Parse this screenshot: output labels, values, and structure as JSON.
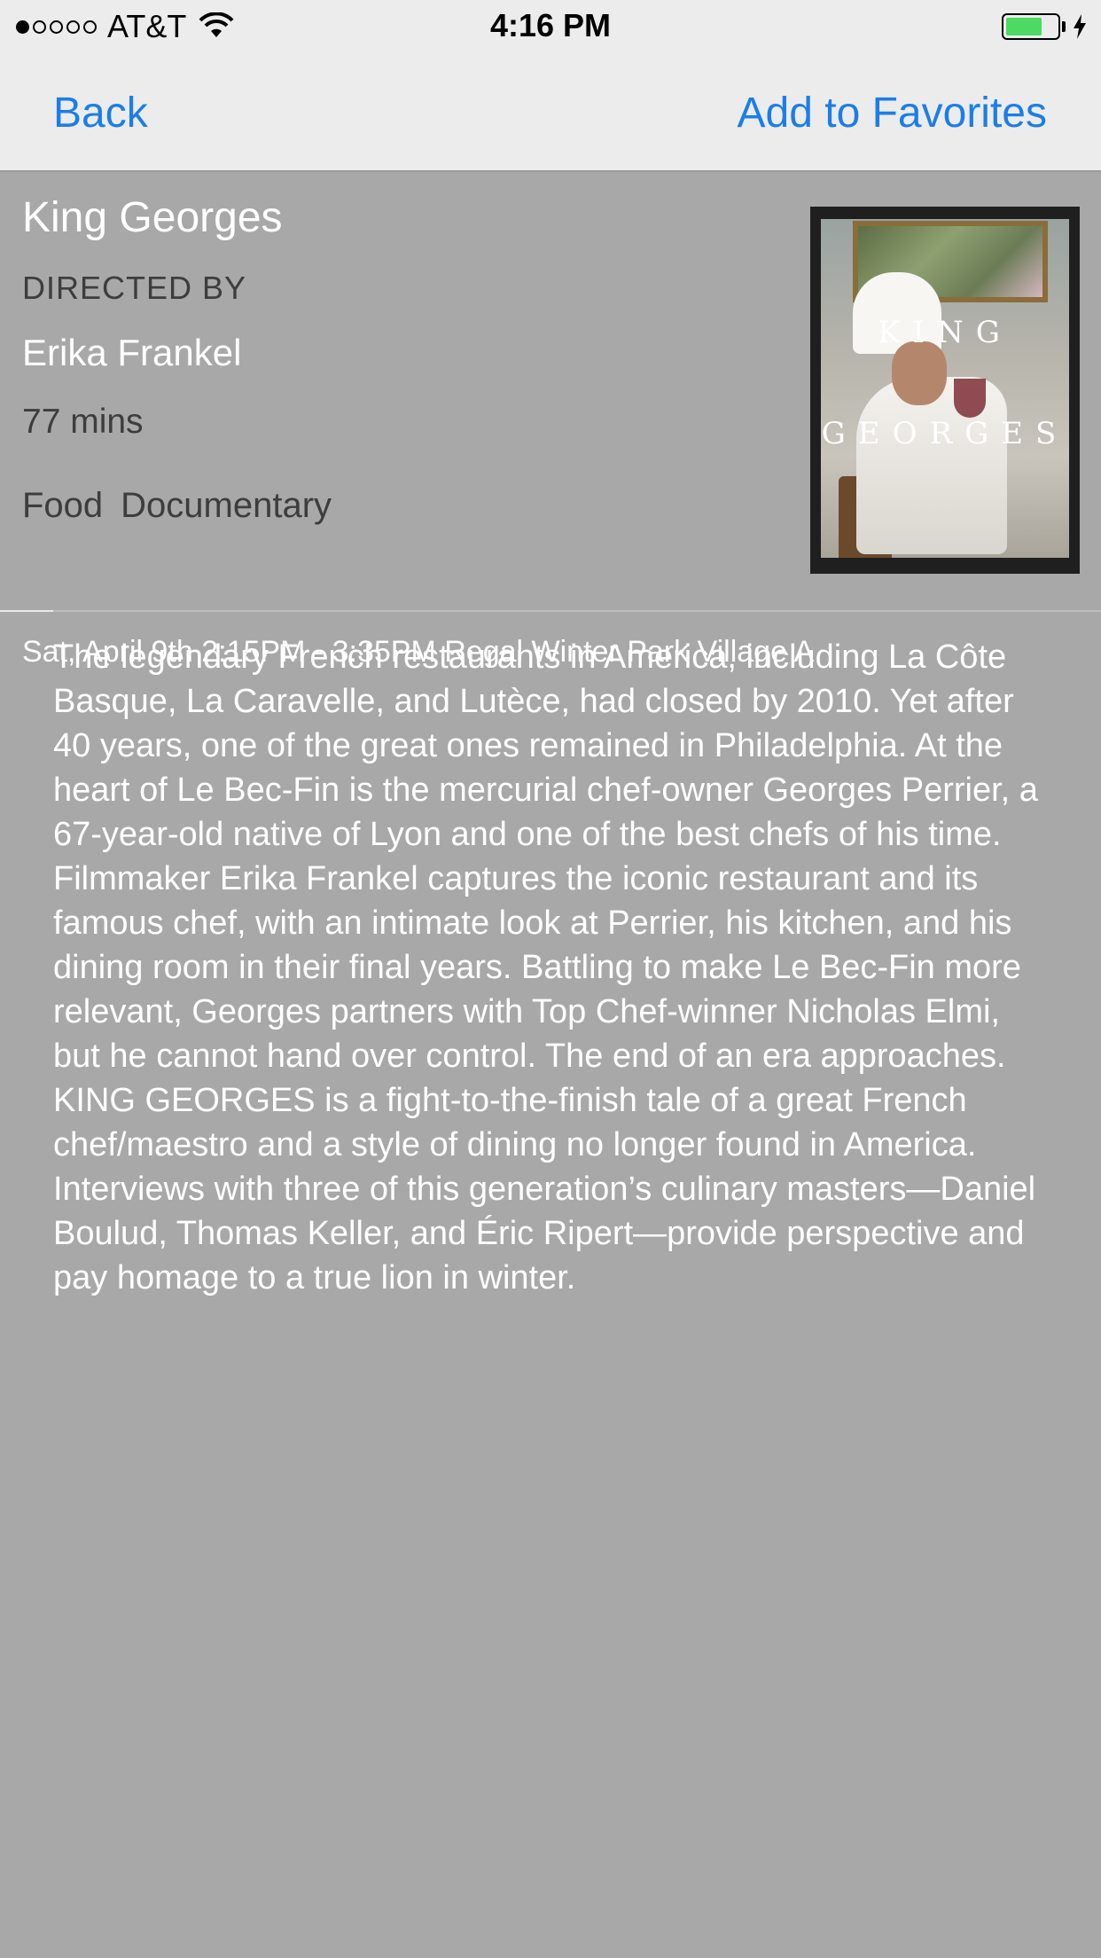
{
  "status_bar": {
    "carrier": "AT&T",
    "time": "4:16 PM",
    "signal_bars_filled": 1,
    "signal_bars_total": 5,
    "battery_level": 0.72,
    "battery_color": "#4cd964"
  },
  "nav": {
    "back_label": "Back",
    "favorites_label": "Add to Favorites",
    "accent_color": "#1b7ee8"
  },
  "film": {
    "title": "King Georges",
    "directed_by_label": "DIRECTED BY",
    "director": "Erika Frankel",
    "runtime": "77 mins",
    "genres": [
      "Food",
      "Documentary"
    ],
    "showtime": "Sat, April 9th 2:15PM - 3:35PM Regal Winter Park Village A",
    "poster": {
      "line1": "KING",
      "line2": "GEORGES"
    },
    "description": "The legendary French restaurants in America, including La Côte Basque, La Caravelle, and Lutèce, had closed by 2010. Yet after 40 years, one of the great ones remained in Philadelphia. At the heart of Le Bec-Fin is the mercurial chef-owner Georges Perrier, a 67-year-old native of Lyon and one of the best chefs of his time. Filmmaker Erika Frankel captures the iconic restaurant and its famous chef, with an intimate look at Perrier, his kitchen, and his dining room in their final years. Battling to make Le Bec-Fin more relevant, Georges partners with Top Chef-winner Nicholas Elmi, but he cannot hand over control. The end of an era approaches. KING GEORGES is a fight-to-the-finish tale of a great French chef/maestro and a style of dining no longer found in America. Interviews with three of this generation’s culinary masters—Daniel Boulud, Thomas Keller, and Éric Ripert—provide perspective and pay homage to a true lion in winter."
  }
}
